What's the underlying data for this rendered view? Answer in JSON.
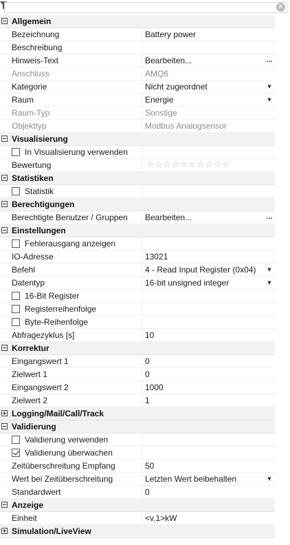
{
  "toolbar": {
    "search_placeholder": "",
    "search_value": ""
  },
  "icons": {
    "filter": "filter-icon",
    "clear": "clear-icon",
    "star": "star-icon",
    "dropdown": "chevron-down-icon",
    "ellipsis": "ellipsis-icon"
  },
  "colors": {
    "category_bg": "#f2f2f2",
    "disabled_text": "#8c8c8c",
    "star": "#b8b8b8"
  },
  "rating": {
    "total_stars": 10,
    "value": 0
  },
  "properties": [
    {
      "type": "category",
      "label": "Allgemein",
      "expanded": true
    },
    {
      "type": "prop",
      "name": "Bezeichnung",
      "value": "Battery power"
    },
    {
      "type": "prop",
      "name": "Beschreibung",
      "value": ""
    },
    {
      "type": "prop",
      "name": "Hinweis-Text",
      "value": "Bearbeiten...",
      "editor": "ellipsis"
    },
    {
      "type": "prop",
      "name": "Anschluss",
      "value": "AMQ6",
      "disabled": true
    },
    {
      "type": "prop",
      "name": "Kategorie",
      "value": "Nicht zugeordnet",
      "editor": "dropdown"
    },
    {
      "type": "prop",
      "name": "Raum",
      "value": "Energie",
      "editor": "dropdown"
    },
    {
      "type": "prop",
      "name": "Raum-Typ",
      "value": "Sonstige",
      "disabled": true
    },
    {
      "type": "prop",
      "name": "Objekttyp",
      "value": "Modbus Analogsensor",
      "disabled": true
    },
    {
      "type": "category",
      "label": "Visualisierung",
      "expanded": true
    },
    {
      "type": "check",
      "name": "In Visualisierung verwenden",
      "checked": false
    },
    {
      "type": "rating",
      "name": "Bewertung"
    },
    {
      "type": "category",
      "label": "Statistiken",
      "expanded": true
    },
    {
      "type": "check",
      "name": "Statistik",
      "checked": false
    },
    {
      "type": "category",
      "label": "Berechtigungen",
      "expanded": true
    },
    {
      "type": "prop",
      "name": "Berechtigte Benutzer / Gruppen",
      "value": "Bearbeiten...",
      "editor": "ellipsis"
    },
    {
      "type": "category",
      "label": "Einstellungen",
      "expanded": true
    },
    {
      "type": "check",
      "name": "Fehlerausgang anzeigen",
      "checked": false
    },
    {
      "type": "prop",
      "name": "IO-Adresse",
      "value": "13021"
    },
    {
      "type": "prop",
      "name": "Befehl",
      "value": "4 - Read Input Register (0x04)",
      "editor": "dropdown"
    },
    {
      "type": "prop",
      "name": "Datentyp",
      "value": "16-bit unsigned integer",
      "editor": "dropdown"
    },
    {
      "type": "check",
      "name": "16-Bit Register",
      "checked": false
    },
    {
      "type": "check",
      "name": "Registerreihenfolge",
      "checked": false
    },
    {
      "type": "check",
      "name": "Byte-Reihenfolge",
      "checked": false
    },
    {
      "type": "prop",
      "name": "Abfragezyklus [s]",
      "value": "10"
    },
    {
      "type": "category",
      "label": "Korrektur",
      "expanded": true
    },
    {
      "type": "prop",
      "name": "Eingangswert 1",
      "value": "0"
    },
    {
      "type": "prop",
      "name": "Zielwert 1",
      "value": "0"
    },
    {
      "type": "prop",
      "name": "Eingangswert 2",
      "value": "1000"
    },
    {
      "type": "prop",
      "name": "Zielwert 2",
      "value": "1"
    },
    {
      "type": "category",
      "label": "Logging/Mail/Call/Track",
      "expanded": false
    },
    {
      "type": "category",
      "label": "Validierung",
      "expanded": true
    },
    {
      "type": "check",
      "name": "Validierung verwenden",
      "checked": false
    },
    {
      "type": "check",
      "name": "Validierung überwachen",
      "checked": true
    },
    {
      "type": "prop",
      "name": "Zeitüberschreitung Empfang",
      "value": "50"
    },
    {
      "type": "prop",
      "name": "Wert bei Zeitüberschreitung",
      "value": "Letzten Wert beibehalten",
      "editor": "dropdown"
    },
    {
      "type": "prop",
      "name": "Standardwert",
      "value": "0"
    },
    {
      "type": "category",
      "label": "Anzeige",
      "expanded": true
    },
    {
      "type": "prop",
      "name": "Einheit",
      "value": "<v.1>kW"
    },
    {
      "type": "category",
      "label": "Simulation/LiveView",
      "expanded": false
    }
  ]
}
